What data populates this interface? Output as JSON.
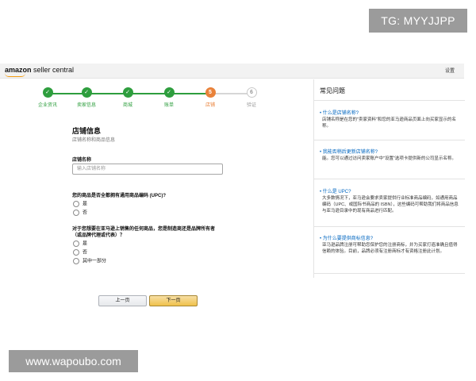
{
  "watermarks": {
    "top": "TG: MYYJJPP",
    "bottom": "www.wapoubo.com"
  },
  "header": {
    "brand_bold": "amazon",
    "brand_rest": " seller central",
    "settings": "设置"
  },
  "steps": [
    {
      "label": "企业资讯",
      "state": "done"
    },
    {
      "label": "卖家信息",
      "state": "done"
    },
    {
      "label": "商城",
      "state": "done"
    },
    {
      "label": "账单",
      "state": "done"
    },
    {
      "label": "店铺",
      "state": "active",
      "number": "5"
    },
    {
      "label": "验证",
      "state": "todo",
      "number": "6"
    }
  ],
  "form": {
    "title": "店铺信息",
    "subtitle": "店铺名称和商品信息",
    "store_name_label": "店铺名称",
    "store_name_placeholder": "输入店铺名称",
    "store_name_value": "",
    "q1": "您的商品是否全都拥有通用商品编码 (UPC)?",
    "q1_options": [
      "是",
      "否"
    ],
    "q2_line1": "对于您想要在亚马逊上销售的任何商品，您是制造商还是品牌所有者",
    "q2_line2": "（或品牌代理或代表）？",
    "q2_options": [
      "是",
      "否",
      "其中一部分"
    ]
  },
  "buttons": {
    "prev": "上一页",
    "next": "下一页"
  },
  "sidebar": {
    "title": "常见问题",
    "faqs": [
      {
        "q": "• 什么是店铺名称?",
        "a": "店铺名称是在您的\"卖家资料\"和您的亚马逊商品页面上向买家显示的名称。"
      },
      {
        "q": "• 我能否稍后更新店铺名称?",
        "a": "能。您可以通过访问卖家账户中\"设置\"选项卡提供新的公司显示名称。"
      },
      {
        "q": "• 什么是 UPC?",
        "a": "大多数情况下，亚马逊会要求卖家提供行业标准商品编码，如通用商品编码（UPC、或国际书商品的 ISBN），这些编码可帮助我们将商品信息与亚马逊目录中的现有商品进行匹配。"
      },
      {
        "q": "• 为什么要提供商标信息?",
        "a": "亚马逊品牌注册可帮助您保护您的注册商标，并为买家打造准确且值得信赖的体验。目前，品牌必须有注册商标才有资格注册此计划。"
      }
    ]
  }
}
